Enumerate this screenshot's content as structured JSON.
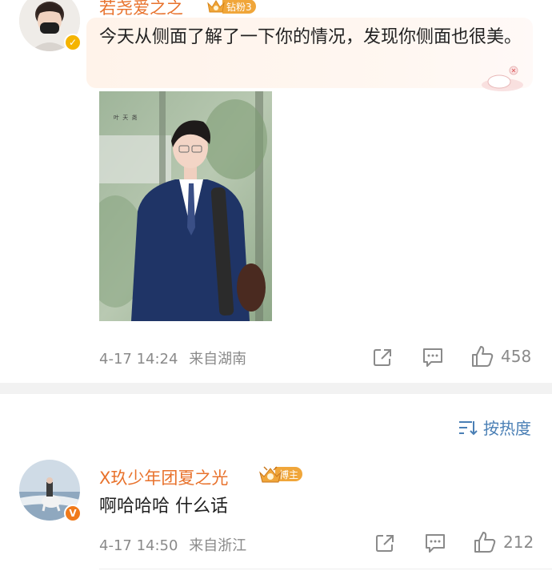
{
  "comments": [
    {
      "username": "若尧爱之之",
      "fan_badge": "钻粉3",
      "text": "今天从侧面了解了一下你的情况，发现你侧面也很美。",
      "photo_caption": "叶  天  尧",
      "time": "4-17 14:24",
      "location": "来自湖南",
      "likes": "458"
    },
    {
      "username": "X玖少年团夏之光",
      "fan_badge": "博主",
      "text": "啊哈哈哈 什么话",
      "time": "4-17 14:50",
      "location": "来自浙江",
      "likes": "212"
    }
  ],
  "sort_label": "按热度",
  "colors": {
    "username": "#e8722c",
    "meta": "#8a8a8a",
    "sort": "#4a7fb5",
    "badge_gold": "#f0a63a",
    "verify_gold": "#f5b400",
    "verify_orange": "#f07a1a"
  },
  "icons": [
    "share-icon",
    "comment-icon",
    "like-icon",
    "sort-icon",
    "verified-icon"
  ]
}
